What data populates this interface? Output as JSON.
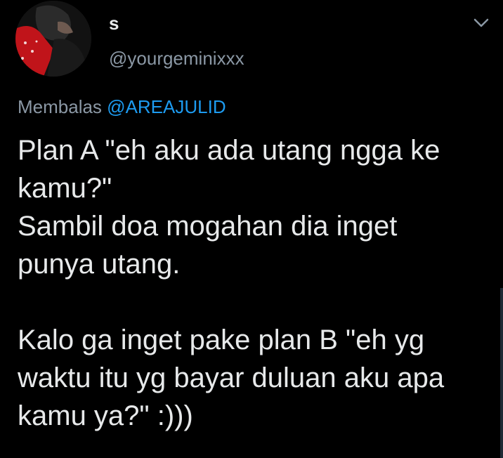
{
  "user": {
    "display_name": "s",
    "handle": "@yourgeminixxx",
    "avatar_icon": "profile-photo"
  },
  "reply": {
    "prefix": "Membalas",
    "mention": "@AREAJULID"
  },
  "tweet": {
    "line1": "Plan A \"eh aku ada utang ngga ke",
    "line2": "kamu?\"",
    "line3": "Sambil doa mogahan dia inget",
    "line4": "punya utang.",
    "line5": "Kalo ga inget pake plan B \"eh yg",
    "line6": "waktu itu yg bayar duluan aku apa",
    "line7": "kamu ya?\" :)))"
  },
  "colors": {
    "background": "#000000",
    "text": "#e7e9ea",
    "secondary": "#8b98a5",
    "link": "#1d9bf0"
  },
  "icons": {
    "more": "chevron-down-icon"
  }
}
